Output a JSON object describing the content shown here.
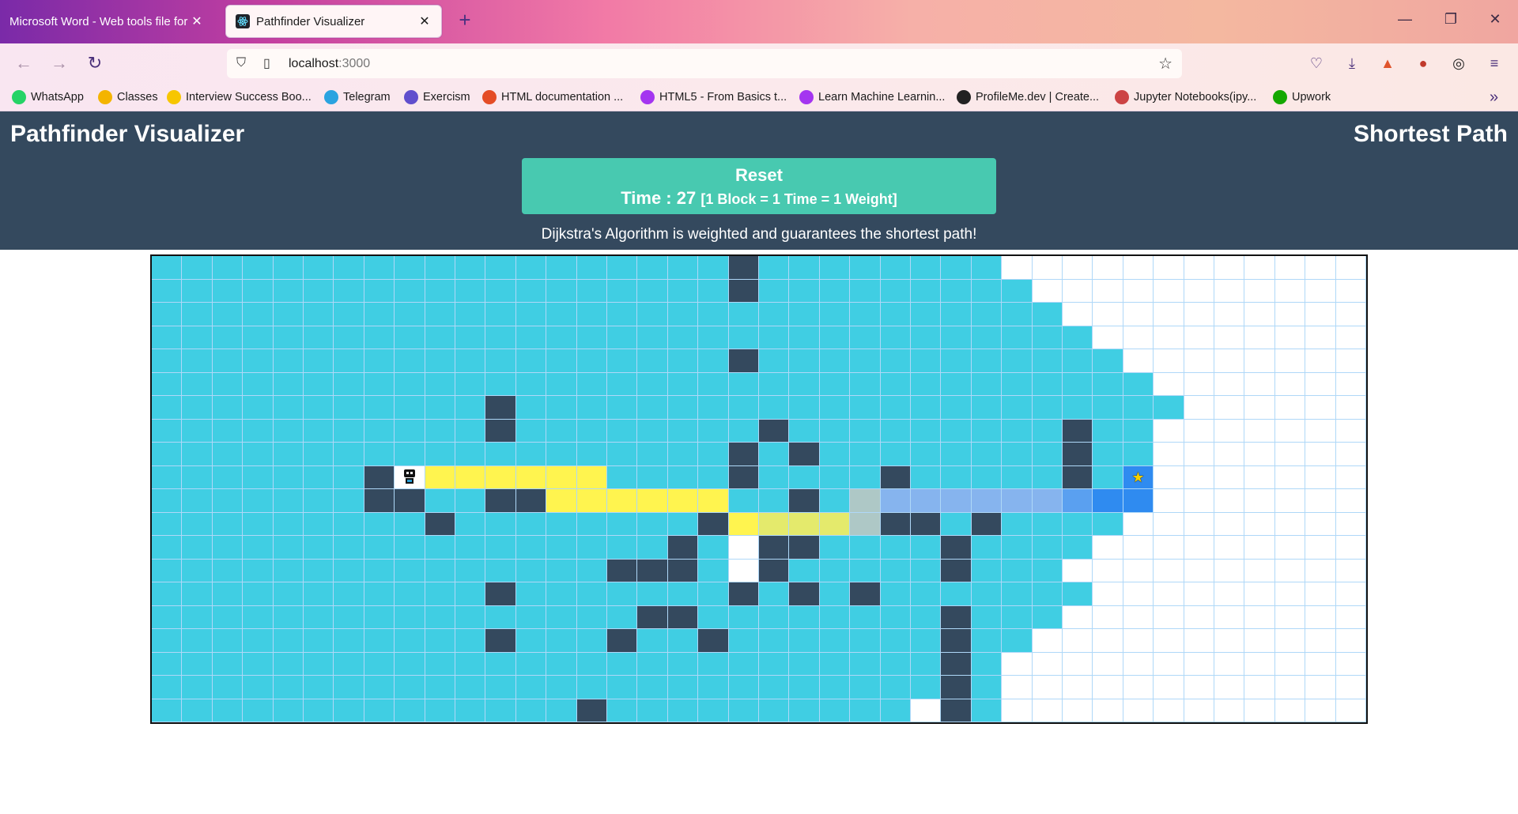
{
  "browser": {
    "tabs": [
      {
        "label": "Microsoft Word - Web tools file for",
        "active": false
      },
      {
        "label": "Pathfinder Visualizer",
        "active": true
      }
    ],
    "url_host": "localhost",
    "url_port": ":3000",
    "bookmarks": [
      {
        "label": "WhatsApp",
        "icon": "whatsapp-icon",
        "color": "#25d366"
      },
      {
        "label": "Classes",
        "icon": "classroom-icon",
        "color": "#f4b400"
      },
      {
        "label": "Interview Success Boo...",
        "icon": "book-icon",
        "color": "#f7c600"
      },
      {
        "label": "Telegram",
        "icon": "telegram-icon",
        "color": "#2aa3e0"
      },
      {
        "label": "Exercism",
        "icon": "exercism-icon",
        "color": "#604fcd"
      },
      {
        "label": "HTML documentation ...",
        "icon": "document-icon",
        "color": "#e44d26"
      },
      {
        "label": "HTML5 - From Basics t...",
        "icon": "udemy-icon",
        "color": "#a435f0"
      },
      {
        "label": "Learn Machine Learnin...",
        "icon": "udemy-icon",
        "color": "#a435f0"
      },
      {
        "label": "ProfileMe.dev | Create...",
        "icon": "profileme-icon",
        "color": "#222222"
      },
      {
        "label": "Jupyter Notebooks(ipy...",
        "icon": "jupyter-icon",
        "color": "#c44"
      },
      {
        "label": "Upwork",
        "icon": "upwork-icon",
        "color": "#14a800"
      }
    ]
  },
  "app": {
    "title": "Pathfinder Visualizer",
    "mode": "Shortest Path",
    "reset_label": "Reset",
    "time_label": "Time : 27",
    "time_note": "[1 Block = 1 Time = 1 Weight]",
    "description": "Dijkstra's Algorithm is weighted and guarantees the shortest path!",
    "colors": {
      "header": "#34495e",
      "reset": "#48c9b0",
      "visited": "#40cee3",
      "wall": "#34495e",
      "path": "#fff44f",
      "path_end": "#2f8bf0"
    }
  },
  "grid": {
    "rows": [
      "vvvvvvvvvvvvvvvvvvvwvvvvvvvveeeeeeeeeeeee",
      "vvvvvvvvvvvvvvvvvvvwvvvvvvvvveeeeeeeeeeee",
      "vvvvvvvvvvvvvvvvvvvvvvvvvvvvvveeeeeeeeeee",
      "vvvvvvvvvvvvvvvvvvvvvvvvvvvvvvveeeeeeeeee",
      "vvvvvvvvvvvvvvvvvvvwvvvvvvvvvvvveeeeeeeee",
      "vvvvvvvvvvvvvvvvvvvvvvvvvvvvvvvvveeeeeeee",
      "vvvvvvvvvvvwvvvvvvvvvvvvvvvvvvvvvveeeeeee",
      "vvvvvvvvvvvwvvvvvvvvwvvvvvvvvvwvveeeeeeee",
      "vvvvvvvvvvvvvvvvvvvwvwvvvvvvvvwvveeeeeeee",
      "vvvvvvvwsppppppvvvvwvvvvwvvvvvwvteeeeeeee",
      "vvvvvvvwwvvwwppppppvvwvqbbbbbbBCCeeeeeeee",
      "vvvvvvvvvwvvvvvvvvwprrrqwwvwvvvveeeeeeeee",
      "vvvvvvvvvvvvvvvvvwvewwvvvvwvvvveeeeeeeeee",
      "vvvvvvvvvvvvvvvwwwvewvvvvvwvvveeeeeeeeeee",
      "vvvvvvvvvvvwvvvvvvvwvwvwvvvvvvveeeeeeeeee",
      "vvvvvvvvvvvvvvvvwwvvvvvvvvwvvveeeeeeeeeee",
      "vvvvvvvvvvvwvvvwvvwvvvvvvvwvveeeeeeeeeeee",
      "vvvvvvvvvvvvvvvvvvvvvvvvvvwveeeeeeeeeeeee",
      "vvvvvvvvvvvvvvvvvvvvvvvvvvwveeeeeeeeeeeee",
      "vvvvvvvvvvvvvvwvvvvvvvvvvewveeeeeeeeeeeee"
    ],
    "legend": {
      "v": "visited-cell",
      "e": "empty-cell",
      "w": "wall-cell",
      "p": "path-cell",
      "r": "path-cell",
      "q": "path-cell",
      "b": "path-cell",
      "B": "path-cell",
      "C": "path-cell",
      "s": "start-node",
      "t": "target-node"
    }
  }
}
